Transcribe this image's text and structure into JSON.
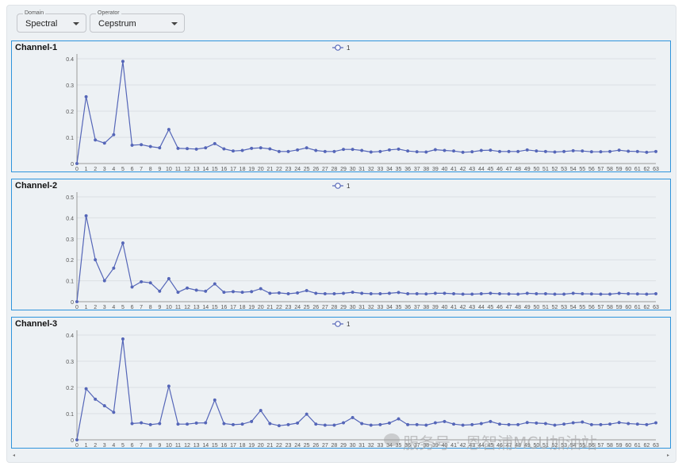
{
  "controls": {
    "domain": {
      "label": "Domain",
      "value": "Spectral"
    },
    "operator": {
      "label": "Operator",
      "value": "Cepstrum"
    }
  },
  "watermark": "服务号 · 恩智浦MCU加油站",
  "colors": {
    "accent": "#5566b8",
    "panel_border": "#2f94dc",
    "background": "#edf1f4"
  },
  "chart_data": [
    {
      "type": "line",
      "title": "Channel-1",
      "legend": "top-center",
      "grid": true,
      "x": [
        0,
        1,
        2,
        3,
        4,
        5,
        6,
        7,
        8,
        9,
        10,
        11,
        12,
        13,
        14,
        15,
        16,
        17,
        18,
        19,
        20,
        21,
        22,
        23,
        24,
        25,
        26,
        27,
        28,
        29,
        30,
        31,
        32,
        33,
        34,
        35,
        36,
        37,
        38,
        39,
        40,
        41,
        42,
        43,
        44,
        45,
        46,
        47,
        48,
        49,
        50,
        51,
        52,
        53,
        54,
        55,
        56,
        57,
        58,
        59,
        60,
        61,
        62,
        63
      ],
      "ylim": [
        0,
        0.4
      ],
      "yticks": [
        0,
        0.1,
        0.2,
        0.3,
        0.4
      ],
      "series": [
        {
          "name": "1",
          "values": [
            0,
            0.255,
            0.09,
            0.078,
            0.11,
            0.39,
            0.07,
            0.072,
            0.065,
            0.06,
            0.13,
            0.058,
            0.057,
            0.055,
            0.06,
            0.076,
            0.056,
            0.048,
            0.05,
            0.058,
            0.06,
            0.056,
            0.046,
            0.046,
            0.052,
            0.06,
            0.05,
            0.046,
            0.046,
            0.054,
            0.054,
            0.05,
            0.044,
            0.046,
            0.052,
            0.055,
            0.048,
            0.045,
            0.044,
            0.053,
            0.05,
            0.048,
            0.043,
            0.045,
            0.05,
            0.051,
            0.046,
            0.046,
            0.046,
            0.052,
            0.048,
            0.046,
            0.044,
            0.046,
            0.049,
            0.048,
            0.045,
            0.045,
            0.046,
            0.051,
            0.047,
            0.046,
            0.043,
            0.046
          ]
        }
      ]
    },
    {
      "type": "line",
      "title": "Channel-2",
      "legend": "top-center",
      "grid": true,
      "x": [
        0,
        1,
        2,
        3,
        4,
        5,
        6,
        7,
        8,
        9,
        10,
        11,
        12,
        13,
        14,
        15,
        16,
        17,
        18,
        19,
        20,
        21,
        22,
        23,
        24,
        25,
        26,
        27,
        28,
        29,
        30,
        31,
        32,
        33,
        34,
        35,
        36,
        37,
        38,
        39,
        40,
        41,
        42,
        43,
        44,
        45,
        46,
        47,
        48,
        49,
        50,
        51,
        52,
        53,
        54,
        55,
        56,
        57,
        58,
        59,
        60,
        61,
        62,
        63
      ],
      "ylim": [
        0,
        0.5
      ],
      "yticks": [
        0,
        0.1,
        0.2,
        0.3,
        0.4,
        0.5
      ],
      "series": [
        {
          "name": "1",
          "values": [
            0,
            0.41,
            0.2,
            0.1,
            0.16,
            0.28,
            0.07,
            0.095,
            0.09,
            0.05,
            0.11,
            0.045,
            0.065,
            0.055,
            0.05,
            0.085,
            0.045,
            0.048,
            0.045,
            0.048,
            0.062,
            0.04,
            0.042,
            0.038,
            0.042,
            0.053,
            0.04,
            0.038,
            0.038,
            0.04,
            0.045,
            0.04,
            0.038,
            0.038,
            0.04,
            0.044,
            0.038,
            0.038,
            0.037,
            0.04,
            0.04,
            0.038,
            0.036,
            0.036,
            0.038,
            0.04,
            0.038,
            0.037,
            0.036,
            0.04,
            0.038,
            0.038,
            0.036,
            0.036,
            0.04,
            0.038,
            0.037,
            0.036,
            0.036,
            0.04,
            0.038,
            0.037,
            0.036,
            0.038
          ]
        }
      ]
    },
    {
      "type": "line",
      "title": "Channel-3",
      "legend": "top-center",
      "grid": true,
      "x": [
        0,
        1,
        2,
        3,
        4,
        5,
        6,
        7,
        8,
        9,
        10,
        11,
        12,
        13,
        14,
        15,
        16,
        17,
        18,
        19,
        20,
        21,
        22,
        23,
        24,
        25,
        26,
        27,
        28,
        29,
        30,
        31,
        32,
        33,
        34,
        35,
        36,
        37,
        38,
        39,
        40,
        41,
        42,
        43,
        44,
        45,
        46,
        47,
        48,
        49,
        50,
        51,
        52,
        53,
        54,
        55,
        56,
        57,
        58,
        59,
        60,
        61,
        62,
        63
      ],
      "ylim": [
        0,
        0.4
      ],
      "yticks": [
        0,
        0.1,
        0.2,
        0.3,
        0.4
      ],
      "series": [
        {
          "name": "1",
          "values": [
            0,
            0.195,
            0.155,
            0.13,
            0.105,
            0.385,
            0.062,
            0.065,
            0.058,
            0.062,
            0.205,
            0.06,
            0.06,
            0.064,
            0.065,
            0.152,
            0.062,
            0.058,
            0.06,
            0.07,
            0.112,
            0.062,
            0.054,
            0.058,
            0.064,
            0.098,
            0.06,
            0.056,
            0.056,
            0.065,
            0.085,
            0.062,
            0.056,
            0.058,
            0.064,
            0.08,
            0.058,
            0.058,
            0.056,
            0.065,
            0.07,
            0.06,
            0.056,
            0.058,
            0.062,
            0.07,
            0.06,
            0.058,
            0.058,
            0.066,
            0.064,
            0.062,
            0.056,
            0.06,
            0.065,
            0.068,
            0.058,
            0.058,
            0.06,
            0.066,
            0.062,
            0.06,
            0.058,
            0.065
          ]
        }
      ]
    }
  ]
}
